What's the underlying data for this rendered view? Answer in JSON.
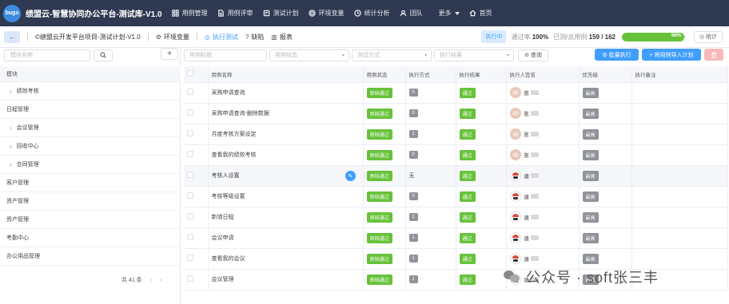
{
  "app": {
    "logo_text": "bugs",
    "title": "绩盟云-智慧协同办公平台-测试库-V1.0"
  },
  "topnav": {
    "items": [
      {
        "label": "用例管理",
        "icon": "grid-icon"
      },
      {
        "label": "用例评审",
        "icon": "document-icon"
      },
      {
        "label": "测试计划",
        "icon": "plan-icon"
      },
      {
        "label": "环境变量",
        "icon": "gear-icon"
      },
      {
        "label": "统计分析",
        "icon": "clock-icon"
      },
      {
        "label": "团队",
        "icon": "user-icon"
      }
    ],
    "more_label": "更多",
    "home_label": "首页"
  },
  "subbar": {
    "back_icon": "arrow-left-icon",
    "crumbs": [
      {
        "label": "©绩盟云开发平台项目-测试计划-V1.0",
        "icon": "©"
      },
      {
        "label": "环境变量",
        "icon": "⚙"
      },
      {
        "label": "执行测试",
        "icon": "◎"
      },
      {
        "label": "缺陷",
        "icon": "?"
      },
      {
        "label": "报表",
        "icon": "▥"
      }
    ],
    "exec_tag": "执行中",
    "pass_rate_label": "通过率",
    "pass_rate_value": "100%",
    "tested_label": "已测/总用例",
    "tested_value": "159 / 162",
    "progress_percent": 98,
    "progress_text": "98%",
    "stats_label": "◎ 统计"
  },
  "left": {
    "search_placeholder": "模块名称",
    "add_label": "+",
    "tree_header": "模块",
    "tree": [
      {
        "label": "绩效考核",
        "child": true
      },
      {
        "label": "日程管理",
        "child": false
      },
      {
        "label": "会议管理",
        "child": true
      },
      {
        "label": "回收中心",
        "child": true
      },
      {
        "label": "合同管理",
        "child": true
      },
      {
        "label": "客户管理",
        "child": false
      },
      {
        "label": "资产管理",
        "child": false
      },
      {
        "label": "资产管理",
        "child": false
      },
      {
        "label": "考勤中心",
        "child": false
      },
      {
        "label": "办公用品管理",
        "child": false
      }
    ],
    "pager_total": "共 41 条",
    "pager_prev": "‹",
    "pager_next": "›"
  },
  "filters": {
    "case_placeholder": "用例标题",
    "status_placeholder": "用例状态",
    "method_placeholder": "测试方式",
    "result_placeholder": "执行结果",
    "query_label": "⊖ 查询",
    "batch_label": "⚙ 批量执行",
    "import_label": "+ 将用例导入计划",
    "delete_icon": "trash-icon"
  },
  "table": {
    "headers": [
      "",
      "用例名称",
      "用例状态",
      "执行方式",
      "执行结果",
      "执行人签名",
      "优先级",
      "执行备注"
    ],
    "rows": [
      {
        "name": "采购申请查询",
        "status": "审核通过",
        "method": "0",
        "result": "通过",
        "person": "陈",
        "avatar": "a",
        "priority": "最高",
        "note": ""
      },
      {
        "name": "采购申请查询-删除数据",
        "status": "审核通过",
        "method": "0",
        "result": "通过",
        "person": "陈",
        "avatar": "a",
        "priority": "最高",
        "note": ""
      },
      {
        "name": "月度考核方案设定",
        "status": "审核通过",
        "method": "1",
        "result": "通过",
        "person": "陈",
        "avatar": "a",
        "priority": "最高",
        "note": ""
      },
      {
        "name": "查看我的绩效考核",
        "status": "审核通过",
        "method": "0",
        "result": "通过",
        "person": "陈",
        "avatar": "a",
        "priority": "最高",
        "note": ""
      },
      {
        "name": "考核人设置",
        "status": "审核通过",
        "method": "无",
        "result": "通过",
        "person": "唐",
        "avatar": "b",
        "priority": "最高",
        "note": ""
      },
      {
        "name": "考核等级设置",
        "status": "审核通过",
        "method": "0",
        "result": "通过",
        "person": "唐",
        "avatar": "b",
        "priority": "最高",
        "note": ""
      },
      {
        "name": "新增日程",
        "status": "审核通过",
        "method": "1",
        "result": "通过",
        "person": "唐",
        "avatar": "b",
        "priority": "最高",
        "note": ""
      },
      {
        "name": "会议申请",
        "status": "审核通过",
        "method": "1",
        "result": "通过",
        "person": "唐",
        "avatar": "b",
        "priority": "最高",
        "note": ""
      },
      {
        "name": "查看我的会议",
        "status": "审核通过",
        "method": "1",
        "result": "通过",
        "person": "唐",
        "avatar": "b",
        "priority": "最高",
        "note": ""
      },
      {
        "name": "会议管理",
        "status": "审核通过",
        "method": "1",
        "result": "通过",
        "person": "唐",
        "avatar": "b",
        "priority": "最高",
        "note": ""
      }
    ],
    "highlight_row": 4
  },
  "watermark": {
    "text": "公众号 · soft张三丰"
  },
  "colors": {
    "nav_bg": "#2f3a52",
    "primary": "#409eff",
    "success": "#67c23a",
    "neutral": "#909399"
  }
}
